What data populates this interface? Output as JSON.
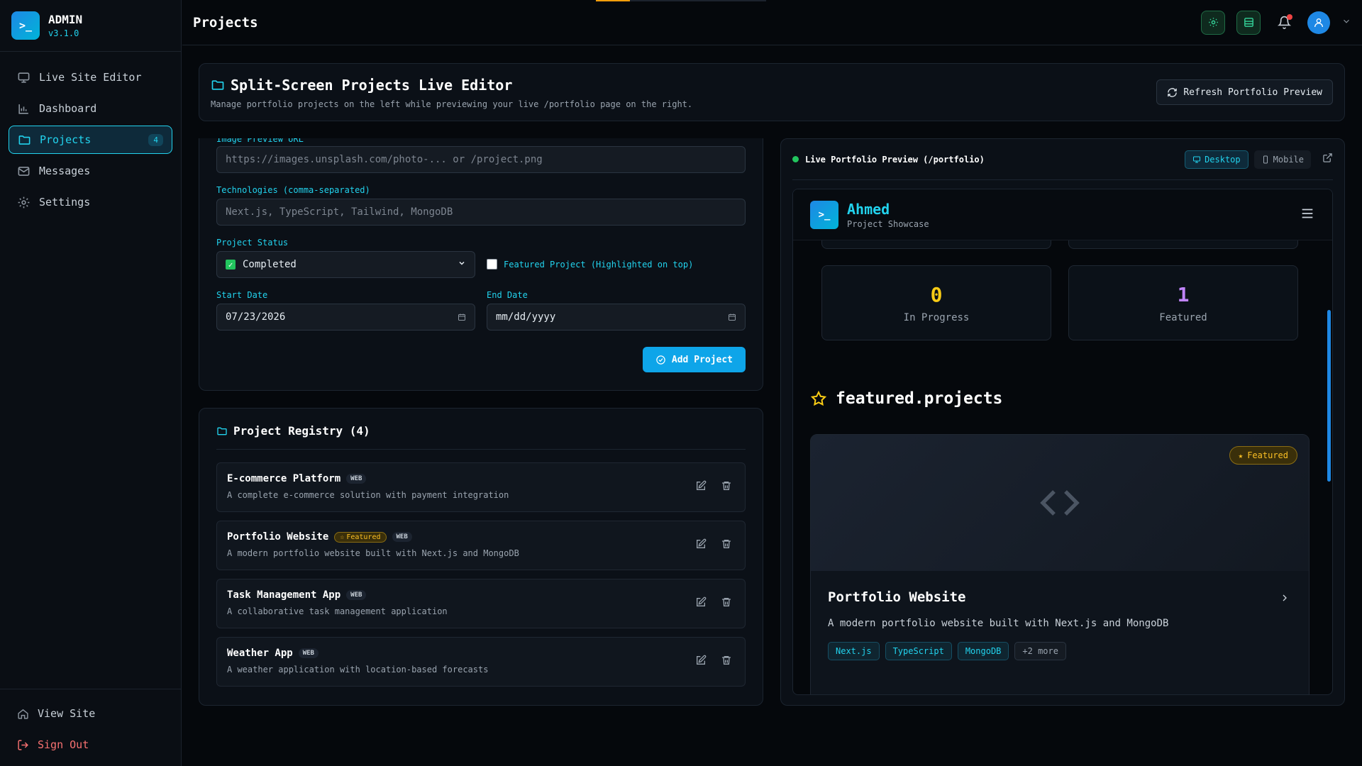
{
  "brand": {
    "name": "ADMIN",
    "version": "v3.1.0",
    "logo_glyph": ">_"
  },
  "nav": {
    "items": [
      {
        "label": "Live Site Editor",
        "icon": "monitor-icon"
      },
      {
        "label": "Dashboard",
        "icon": "chart-icon"
      },
      {
        "label": "Projects",
        "icon": "folder-icon",
        "badge": "4",
        "active": true
      },
      {
        "label": "Messages",
        "icon": "mail-icon"
      },
      {
        "label": "Settings",
        "icon": "gear-icon"
      }
    ],
    "view_site": "View Site",
    "sign_out": "Sign Out"
  },
  "topbar": {
    "title": "Projects",
    "progress_fraction": 0.2
  },
  "header": {
    "title": "Split-Screen Projects Live Editor",
    "subtitle": "Manage portfolio projects on the left while previewing your live /portfolio page on the right.",
    "refresh_label": "Refresh Portfolio Preview"
  },
  "form": {
    "image_label": "Image Preview URL",
    "image_placeholder": "https://images.unsplash.com/photo-... or /project.png",
    "tech_label": "Technologies (comma-separated)",
    "tech_placeholder": "Next.js, TypeScript, Tailwind, MongoDB",
    "status_label": "Project Status",
    "status_value": "Completed",
    "featured_label": "Featured Project (Highlighted on top)",
    "start_label": "Start Date",
    "start_value": "07/23/2026",
    "end_label": "End Date",
    "end_placeholder": "mm/dd/yyyy",
    "add_label": "Add Project"
  },
  "registry": {
    "title": "Project Registry (4)",
    "items": [
      {
        "name": "E-commerce Platform",
        "type": "WEB",
        "featured": false,
        "desc": "A complete e-commerce solution with payment integration"
      },
      {
        "name": "Portfolio Website",
        "type": "WEB",
        "featured": true,
        "featured_label": "Featured",
        "desc": "A modern portfolio website built with Next.js and MongoDB"
      },
      {
        "name": "Task Management App",
        "type": "WEB",
        "featured": false,
        "desc": "A collaborative task management application"
      },
      {
        "name": "Weather App",
        "type": "WEB",
        "featured": false,
        "desc": "A weather application with location-based forecasts"
      }
    ]
  },
  "preview": {
    "title": "Live Portfolio Preview (/portfolio)",
    "desktop_label": "Desktop",
    "mobile_label": "Mobile",
    "site": {
      "name": "Ahmed",
      "subtitle": "Project Showcase",
      "logo_glyph": ">_",
      "stats": [
        {
          "value": "0",
          "label": "In Progress",
          "color": "#facc15"
        },
        {
          "value": "1",
          "label": "Featured",
          "color": "#c084fc"
        }
      ],
      "featured_heading": "featured.projects",
      "card": {
        "badge": "Featured",
        "title": "Portfolio Website",
        "desc": "A modern portfolio website built with Next.js and MongoDB",
        "tags": [
          "Next.js",
          "TypeScript",
          "MongoDB"
        ],
        "more": "+2 more"
      }
    }
  },
  "colors": {
    "accent": "#22d3ee",
    "primary": "#0ea5e9",
    "success": "#22c55e",
    "warning": "#fbbf24",
    "danger": "#f87171"
  }
}
